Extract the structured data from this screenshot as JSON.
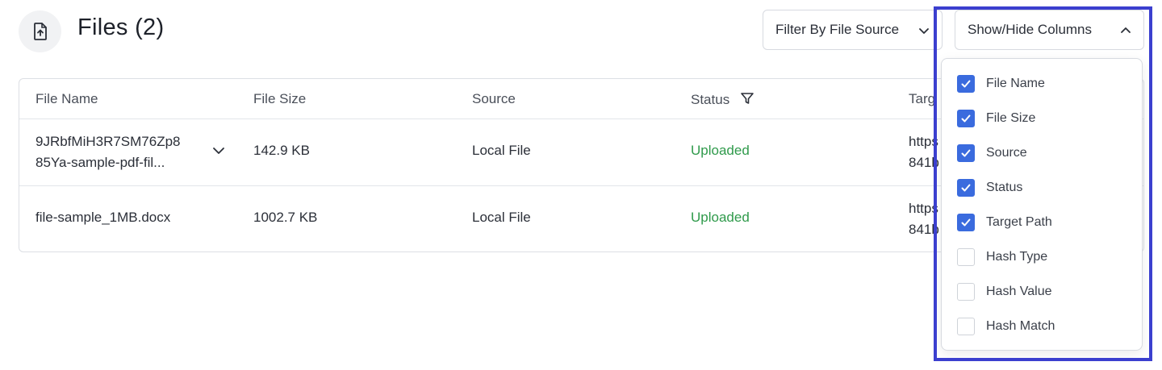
{
  "header": {
    "icon": "file-upload-icon",
    "title": "Files (2)"
  },
  "toolbar": {
    "filter_label": "Filter By File Source",
    "columns_label": "Show/Hide Columns"
  },
  "table": {
    "columns": [
      "File Name",
      "File Size",
      "Source",
      "Status",
      "Targ"
    ],
    "rows": [
      {
        "name_line1": "9JRbfMiH3R7SM76Zp8",
        "name_line2": "85Ya-sample-pdf-fil...",
        "size": "142.9 KB",
        "source": "Local File",
        "status": "Uploaded",
        "target_line1": "https",
        "target_line2": "841b"
      },
      {
        "name": "file-sample_1MB.docx",
        "size": "1002.7 KB",
        "source": "Local File",
        "status": "Uploaded",
        "target_line1": "https",
        "target_line2": "841b"
      }
    ]
  },
  "columns_menu": {
    "items": [
      {
        "label": "File Name",
        "checked": true
      },
      {
        "label": "File Size",
        "checked": true
      },
      {
        "label": "Source",
        "checked": true
      },
      {
        "label": "Status",
        "checked": true
      },
      {
        "label": "Target Path",
        "checked": true
      },
      {
        "label": "Hash Type",
        "checked": false
      },
      {
        "label": "Hash Value",
        "checked": false
      },
      {
        "label": "Hash Match",
        "checked": false
      }
    ]
  },
  "colors": {
    "accent": "#3a6bde",
    "status_ok": "#2f9a4b",
    "highlight": "#3b3fcf"
  }
}
